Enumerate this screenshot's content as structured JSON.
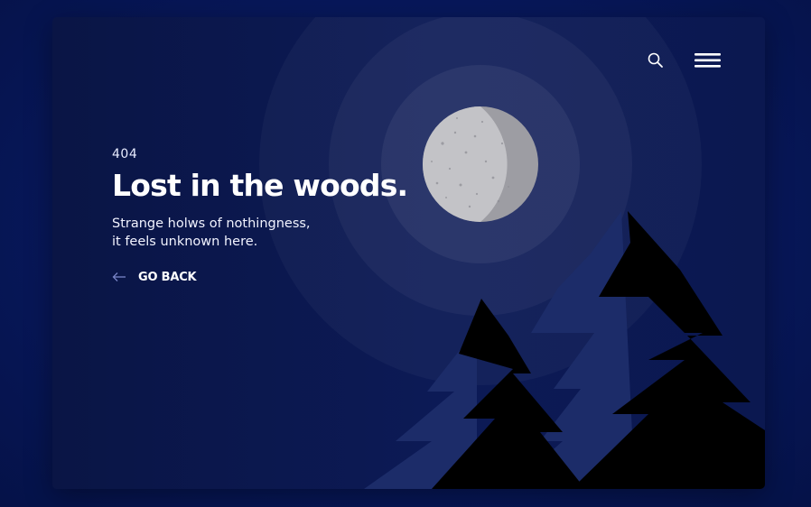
{
  "error_page": {
    "code": "404",
    "title": "Lost in the woods.",
    "subtitle_line1": "Strange holws of nothingness,",
    "subtitle_line2": "it feels unknown here.",
    "back_label": "GO BACK"
  },
  "topbar": {
    "search_icon": "search-icon",
    "menu_icon": "hamburger-menu-icon"
  },
  "colors": {
    "page_background": "#071759",
    "card_background": "#0c1a56",
    "moon": "#c3c3c7",
    "moon_shadow": "#9d9da3",
    "tree_back": "#1c2c69",
    "tree_front": "#000000",
    "arrow": "#7a86c8",
    "text": "#ffffff"
  }
}
